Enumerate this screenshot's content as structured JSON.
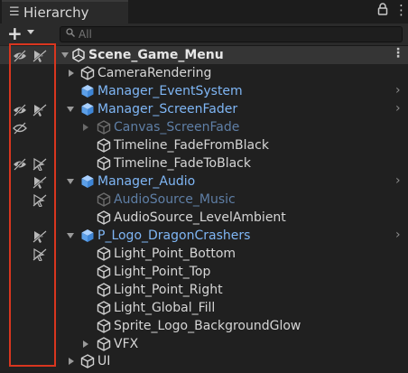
{
  "panel": {
    "tab_label": "Hierarchy",
    "tab_icon": "list-icon",
    "lock_icon": "lock-icon",
    "menu_icon": "kebab-icon"
  },
  "toolbar": {
    "add_label": "+",
    "add_icon": "plus-icon",
    "search_placeholder": "All",
    "search_icon": "search-icon"
  },
  "scene": {
    "name": "Scene_Game_Menu",
    "icon": "unity-scene-icon",
    "menu_icon": "kebab-icon"
  },
  "tree": [
    {
      "name": "CameraRendering",
      "type": "gameobject",
      "state": "normal",
      "fold": "closed",
      "chevron": false
    },
    {
      "name": "Manager_EventSystem",
      "type": "prefab",
      "state": "normal",
      "fold": "none",
      "chevron": true
    },
    {
      "name": "Manager_ScreenFader",
      "type": "prefab",
      "state": "normal",
      "fold": "open",
      "chevron": true
    },
    {
      "name": "Canvas_ScreenFade",
      "type": "gameobject",
      "state": "disabled",
      "fold": "closed",
      "chevron": false
    },
    {
      "name": "Timeline_FadeFromBlack",
      "type": "gameobject",
      "state": "normal",
      "fold": "none",
      "chevron": false
    },
    {
      "name": "Timeline_FadeToBlack",
      "type": "gameobject",
      "state": "normal",
      "fold": "none",
      "chevron": false
    },
    {
      "name": "Manager_Audio",
      "type": "prefab",
      "state": "normal",
      "fold": "open",
      "chevron": true
    },
    {
      "name": "AudioSource_Music",
      "type": "gameobject",
      "state": "disabled",
      "fold": "none",
      "chevron": false
    },
    {
      "name": "AudioSource_LevelAmbient",
      "type": "gameobject",
      "state": "normal",
      "fold": "none",
      "chevron": false
    },
    {
      "name": "P_Logo_DragonCrashers",
      "type": "prefab",
      "state": "normal",
      "fold": "open",
      "chevron": true
    },
    {
      "name": "Light_Point_Bottom",
      "type": "gameobject",
      "state": "normal",
      "fold": "none",
      "chevron": false
    },
    {
      "name": "Light_Point_Top",
      "type": "gameobject",
      "state": "normal",
      "fold": "none",
      "chevron": false
    },
    {
      "name": "Light_Point_Right",
      "type": "gameobject",
      "state": "normal",
      "fold": "none",
      "chevron": false
    },
    {
      "name": "Light_Global_Fill",
      "type": "gameobject",
      "state": "normal",
      "fold": "none",
      "chevron": false
    },
    {
      "name": "Sprite_Logo_BackgroundGlow",
      "type": "gameobject",
      "state": "normal",
      "fold": "none",
      "chevron": false
    },
    {
      "name": "VFX",
      "type": "gameobject",
      "state": "normal",
      "fold": "closed",
      "chevron": false
    },
    {
      "name": "UI",
      "type": "gameobject",
      "state": "normal",
      "fold": "closed",
      "chevron": false
    }
  ],
  "gutter_icons": [
    {
      "row": "scene",
      "icons": [
        "eye-hidden-icon",
        "pick-disabled-icon"
      ]
    },
    {
      "row": "Manager_ScreenFader",
      "icons": [
        "eye-hidden-icon",
        "pick-disabled-icon"
      ]
    },
    {
      "row": "Canvas_ScreenFade",
      "icons": [
        "eye-hidden-icon"
      ]
    },
    {
      "row": "Timeline_FadeToBlack",
      "icons": [
        "eye-hidden-icon",
        "pick-disabled-icon"
      ]
    },
    {
      "row": "Manager_Audio",
      "icons": [
        "pick-disabled-icon"
      ]
    },
    {
      "row": "AudioSource_Music",
      "icons": [
        "pick-disabled-icon"
      ]
    },
    {
      "row": "P_Logo_DragonCrashers",
      "icons": [
        "pick-disabled-icon"
      ]
    },
    {
      "row": "Light_Point_Bottom",
      "icons": [
        "pick-disabled-icon"
      ]
    }
  ],
  "colors": {
    "prefab_blue": "#7fb6f5",
    "disabled_blue": "#5f7fa6",
    "highlight_red": "#d9361f"
  }
}
